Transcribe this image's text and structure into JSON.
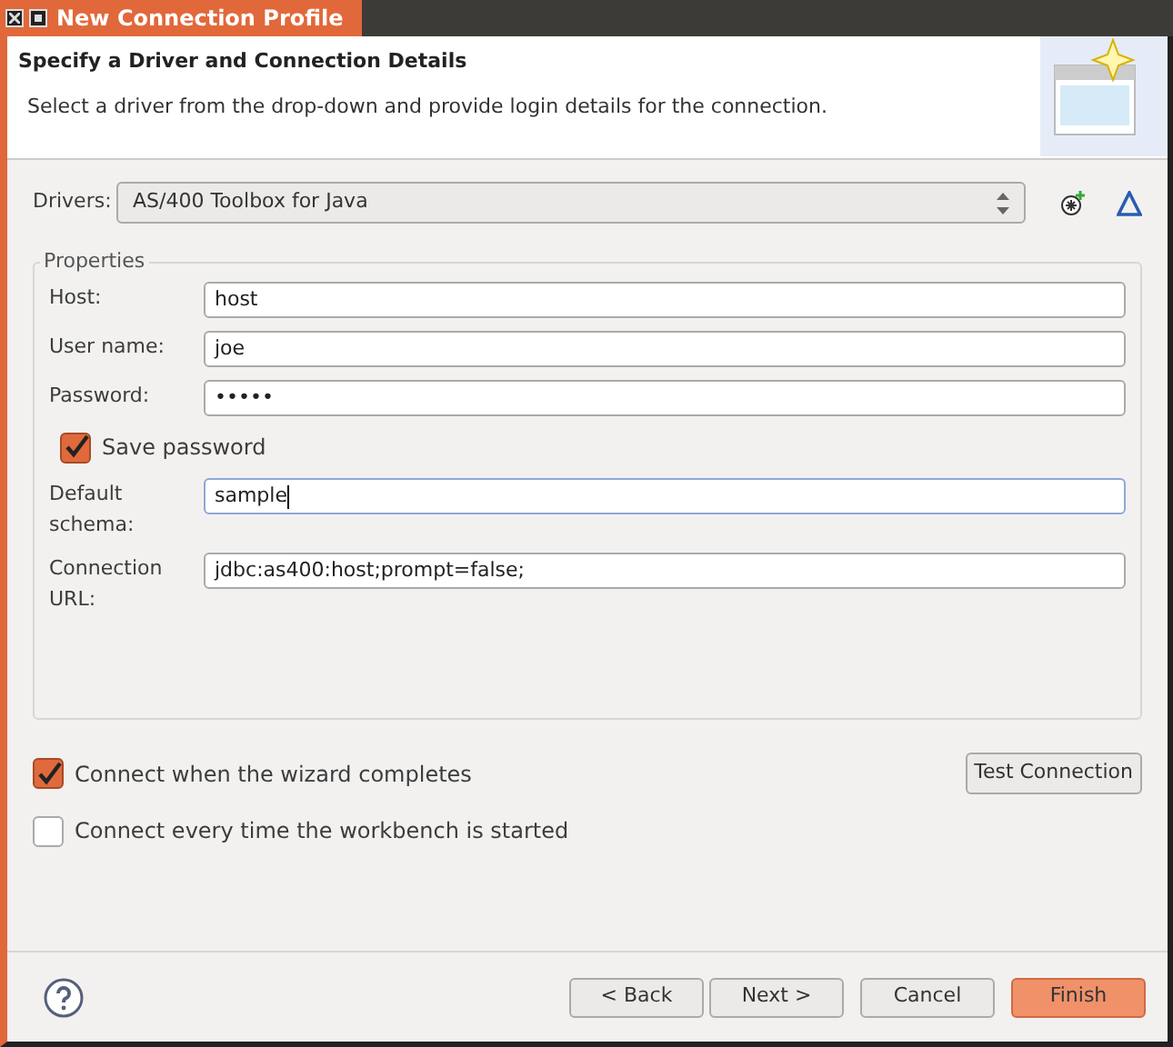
{
  "window": {
    "title": "New Connection Profile"
  },
  "header": {
    "title": "Specify a Driver and Connection Details",
    "description": "Select a driver from the drop-down and provide login details for the connection."
  },
  "drivers": {
    "label": "Drivers:",
    "value": "AS/400 Toolbox for Java"
  },
  "properties": {
    "title": "Properties",
    "fields": [
      {
        "kind": "text",
        "label": "Host:",
        "value": "host",
        "focused": false
      },
      {
        "kind": "text",
        "label": "User name:",
        "value": "joe",
        "focused": false
      },
      {
        "kind": "text",
        "label": "Password:",
        "value": "•••••",
        "focused": false
      },
      {
        "kind": "checkbox",
        "label": "Save password",
        "checked": true
      },
      {
        "kind": "text",
        "label": "Default schema:",
        "value": "sample",
        "focused": true
      },
      {
        "kind": "text",
        "label": "Connection URL:",
        "value": "jdbc:as400:host;prompt=false;",
        "focused": false
      }
    ]
  },
  "options": [
    {
      "label": "Connect when the wizard completes",
      "checked": true
    },
    {
      "label": "Connect every time the workbench is started",
      "checked": false
    }
  ],
  "test_button": "Test Connection",
  "buttons": [
    {
      "label": "< Back",
      "primary": false
    },
    {
      "label": "Next >",
      "primary": false
    },
    {
      "label": "Cancel",
      "primary": false
    },
    {
      "label": "Finish",
      "primary": true
    }
  ]
}
